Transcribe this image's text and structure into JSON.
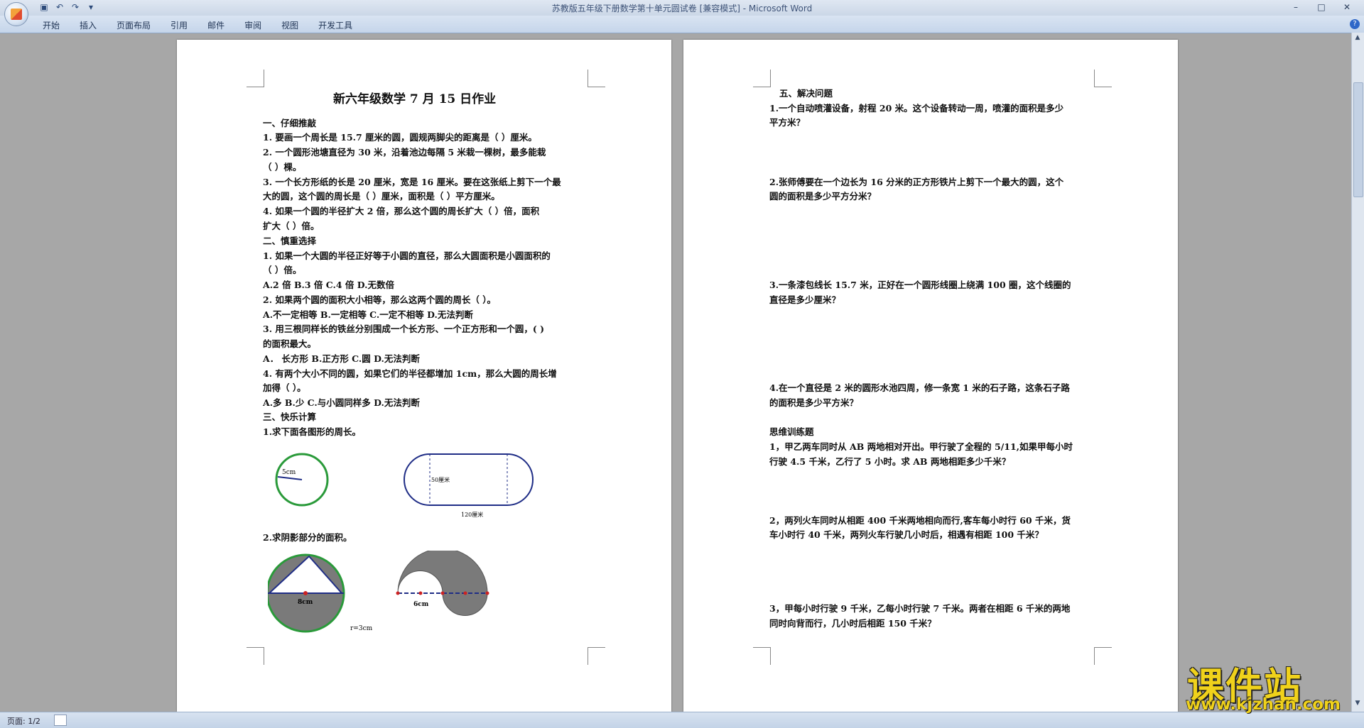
{
  "window": {
    "title": "苏教版五年级下册数学第十单元圆试卷 [兼容模式] - Microsoft Word"
  },
  "quick_access": [
    "save-icon",
    "undo-icon",
    "redo-icon",
    "customize-icon"
  ],
  "ribbon": {
    "tabs": [
      "开始",
      "插入",
      "页面布局",
      "引用",
      "邮件",
      "审阅",
      "视图",
      "开发工具"
    ]
  },
  "status": {
    "page": "页面: 1/2"
  },
  "page1": {
    "title": "新六年级数学 7 月 15 日作业",
    "lines": [
      "一、仔细推敲",
      "1.    要画一个周长是 15.7 厘米的圆，圆规两脚尖的距离是（       ）厘米。",
      "2.    一个圆形池塘直径为 30 米，沿着池边每隔 5 米栽一棵树，最多能栽",
      "        （     ）棵。",
      "3.    一个长方形纸的长是 20 厘米，宽是 16 厘米。要在这张纸上剪下一个最",
      "        大的圆，这个圆的周长是（     ）厘米，面积是（     ）平方厘米。",
      "4.    如果一个圆的半径扩大 2 倍，那么这个圆的周长扩大（      ）倍，面积",
      "        扩大（     ）倍。",
      "二、慎重选择",
      "1.    如果一个大圆的半径正好等于小圆的直径，那么大圆面积是小圆面积的",
      "（    ）倍。",
      "        A.2 倍             B.3 倍               C.4 倍             D.无数倍",
      "2.    如果两个圆的面积大小相等，那么这两个圆的周长（    ）。",
      "        A.不一定相等     B.一定相等       C.一定不相等       D.无法判断",
      "3.    用三根同样长的铁丝分别围成一个长方形、一个正方形和一个圆，(      )",
      "的面积最大。",
      "        A． 长方形          B.正方形          C.圆              D.无法判断",
      "4.    有两个大小不同的圆，如果它们的半径都增加 1cm，那么大圆的周长增",
      "加得（   ）。",
      "        A.多             B.少             C.与小圆同样多          D.无法判断",
      "三、快乐计算",
      "1.求下面各图形的周长。"
    ],
    "fig1": {
      "circle_label": "5cm",
      "rect_side": "50厘米",
      "rect_bottom": "120厘米"
    },
    "section2": "2.求阴影部分的面积。",
    "fig2": {
      "left_label": "8cm",
      "left_radius": "r=3cm",
      "right_label": "6cm"
    }
  },
  "page2": {
    "lines": [
      "五、解决问题",
      "1.一个自动喷灌设备，射程 20 米。这个设备转动一周，喷灌的面积是多少",
      "平方米？",
      "2.张师傅要在一个边长为 16 分米的正方形铁片上剪下一个最大的圆，这个",
      "圆的面积是多少平方分米？",
      "3.一条漆包线长 15.7 米，正好在一个圆形线圈上绕满 100 圈，这个线圈的",
      "直径是多少厘米？",
      "4.在一个直径是 2 米的圆形水池四周，修一条宽 1 米的石子路，这条石子路",
      "的面积是多少平方米？",
      "思维训练题",
      "1，甲乙两车同时从 AB 两地相对开出。甲行驶了全程的 5/11,如果甲每小时",
      "行驶 4.5 千米，乙行了 5 小时。求 AB 两地相距多少千米？",
      "2，两列火车同时从相距 400 千米两地相向而行,客车每小时行 60 千米，货",
      "车小时行 40 千米，两列火车行驶几小时后，相遇有相距 100 千米？",
      "3，甲每小时行驶 9 千米，乙每小时行驶 7 千米。两者在相距 6 千米的两地",
      "同时向背而行，几小时后相距 150 千米？"
    ]
  },
  "watermark": {
    "title": "课件站",
    "url": "www.kjzhan.com"
  },
  "colors": {
    "circle": "#2a9a3a",
    "shape": "#1f2d86",
    "shade": "#7a7a7a",
    "watermark": "#f0d21b"
  }
}
